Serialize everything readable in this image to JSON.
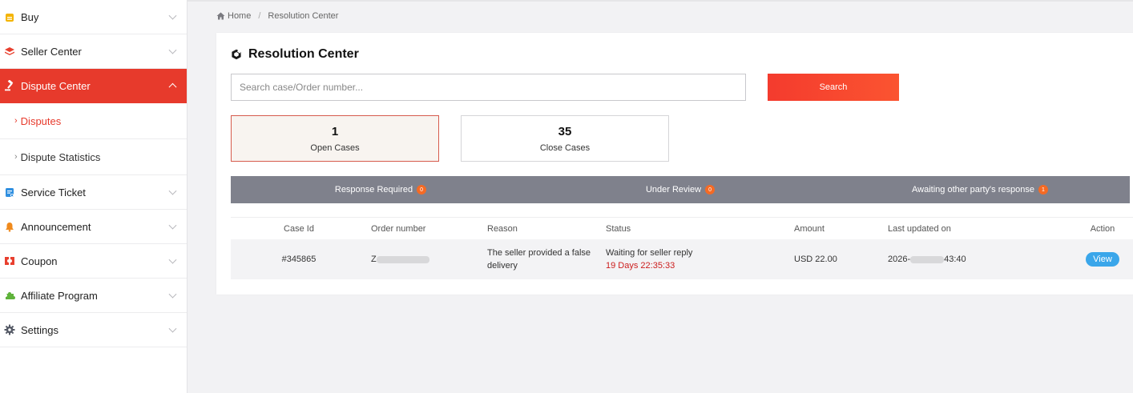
{
  "sidebar": {
    "items": [
      {
        "label": "Buy",
        "icon": "bag-icon"
      },
      {
        "label": "Seller Center",
        "icon": "layers-icon"
      },
      {
        "label": "Dispute Center",
        "icon": "gavel-icon"
      },
      {
        "label": "Service Ticket",
        "icon": "ticket-icon"
      },
      {
        "label": "Announcement",
        "icon": "bell-icon"
      },
      {
        "label": "Coupon",
        "icon": "coupon-icon"
      },
      {
        "label": "Affiliate Program",
        "icon": "puzzle-icon"
      },
      {
        "label": "Settings",
        "icon": "gear-icon"
      }
    ],
    "submenu": [
      {
        "label": "Disputes"
      },
      {
        "label": "Dispute Statistics"
      }
    ]
  },
  "breadcrumb": {
    "home": "Home",
    "current": "Resolution Center"
  },
  "page": {
    "title": "Resolution Center"
  },
  "search": {
    "placeholder": "Search case/Order number...",
    "value": "",
    "button_label": "Search"
  },
  "counts": {
    "open": {
      "number": "1",
      "label": "Open Cases"
    },
    "close": {
      "number": "35",
      "label": "Close Cases"
    }
  },
  "status_tabs": [
    {
      "label": "Response Required",
      "badge": "0"
    },
    {
      "label": "Under Review",
      "badge": "0"
    },
    {
      "label": "Awaiting other party's response",
      "badge": "1"
    }
  ],
  "table": {
    "headers": {
      "case_id": "Case Id",
      "order_number": "Order number",
      "reason": "Reason",
      "status": "Status",
      "amount": "Amount",
      "last_updated": "Last updated on",
      "action": "Action"
    },
    "rows": [
      {
        "case_id": "#345865",
        "order_prefix": "Z",
        "reason": "The seller provided a false delivery",
        "status": "Waiting for seller reply",
        "countdown": "19 Days 22:35:33",
        "amount": "USD 22.00",
        "updated_prefix": "2026-",
        "updated_suffix": "43:40",
        "action": "View"
      }
    ]
  },
  "colors": {
    "accent": "#e73a2c",
    "search_button": "#f4432f",
    "status_bar": "#7f818c",
    "badge": "#f56a24",
    "view_button": "#3aa6ea",
    "countdown": "#cc1d1d"
  }
}
